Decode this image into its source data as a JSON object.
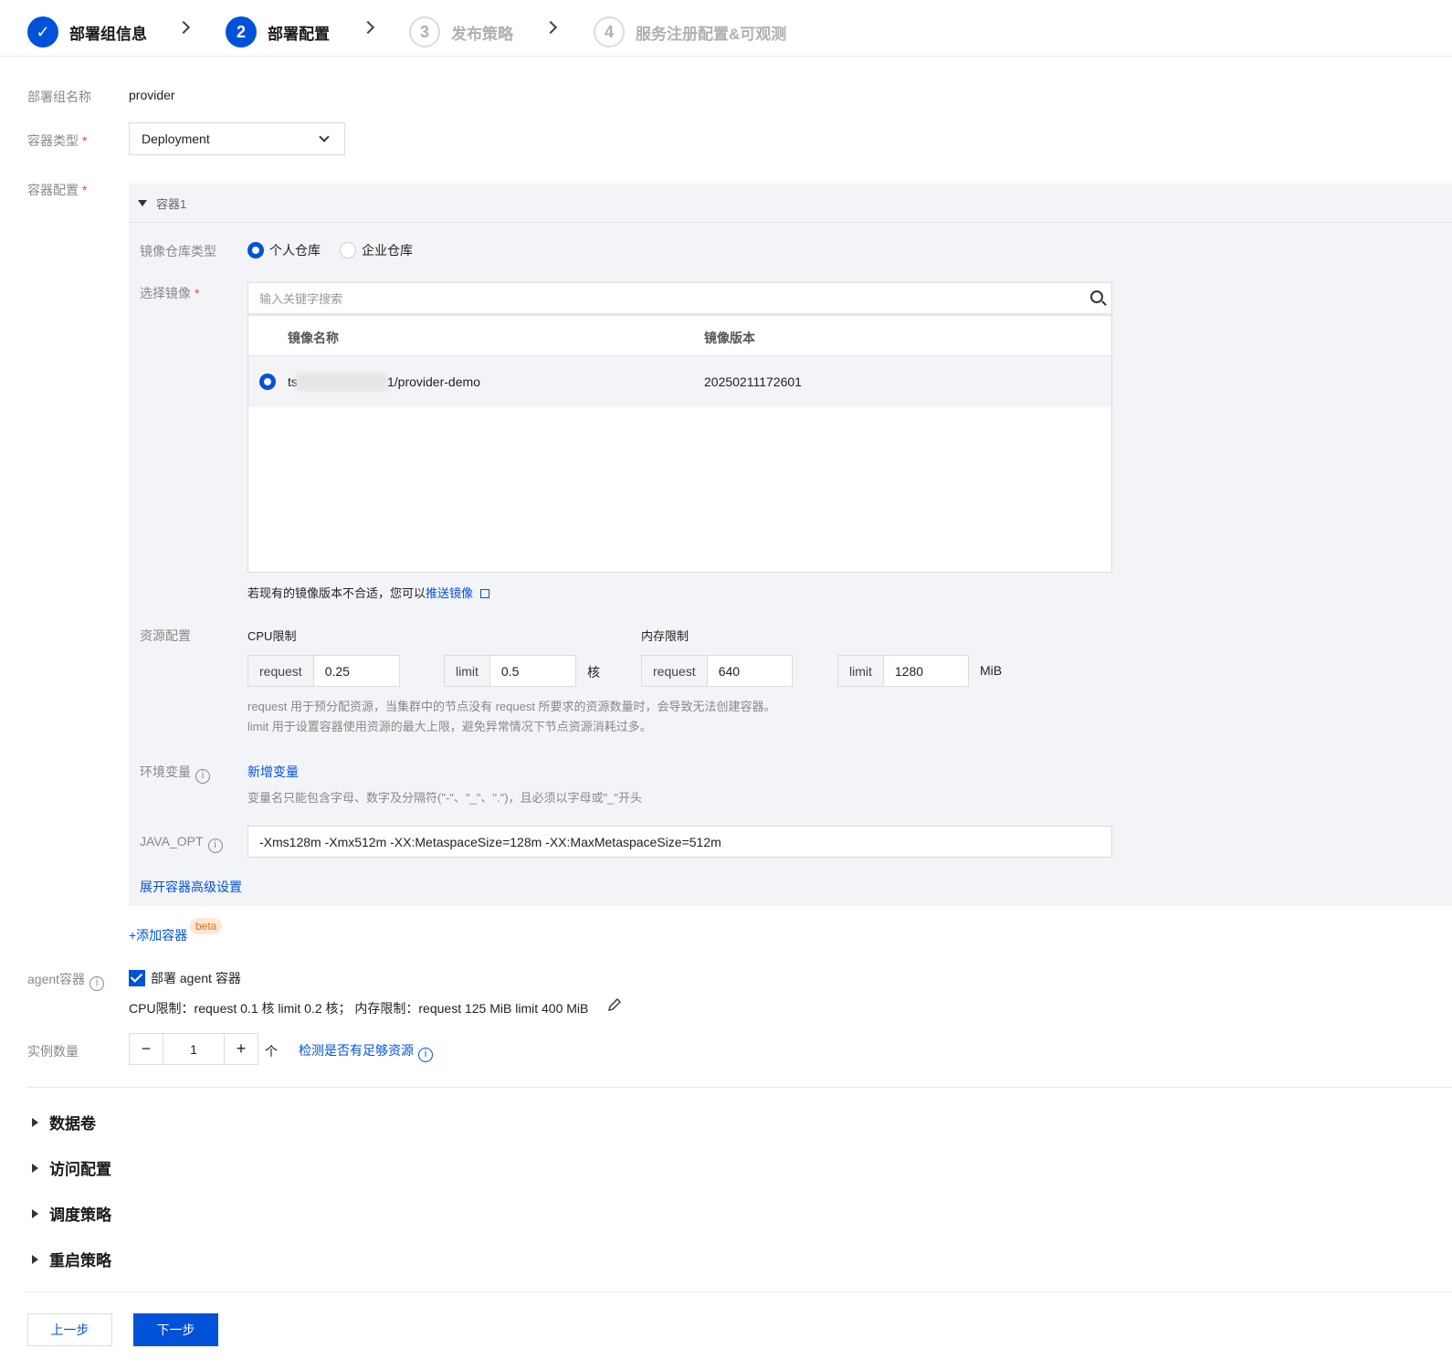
{
  "steps": [
    {
      "num": "✓",
      "label": "部署组信息"
    },
    {
      "num": "2",
      "label": "部署配置"
    },
    {
      "num": "3",
      "label": "发布策略"
    },
    {
      "num": "4",
      "label": "服务注册配置&可观测"
    }
  ],
  "group_name": {
    "label": "部署组名称",
    "value": "provider"
  },
  "container_type": {
    "label": "容器类型",
    "required": "*",
    "value": "Deployment"
  },
  "container_config": {
    "label": "容器配置",
    "required": "*"
  },
  "container1": {
    "title": "容器1",
    "repo_type": {
      "label": "镜像仓库类型",
      "options": [
        "个人仓库",
        "企业仓库"
      ],
      "selected": "个人仓库"
    },
    "select_image": {
      "label": "选择镜像",
      "required": "*",
      "placeholder": "输入关键字搜索"
    },
    "table": {
      "headers": [
        "镜像名称",
        "镜像版本"
      ],
      "rows": [
        {
          "name_prefix": "ts",
          "name_suffix": "1/provider-demo",
          "version": "20250211172601"
        }
      ]
    },
    "push_hint": "若现有的镜像版本不合适，您可以",
    "push_link": "推送镜像",
    "resource": {
      "label": "资源配置",
      "cpu_label": "CPU限制",
      "mem_label": "内存限制",
      "cpu_request_label": "request",
      "cpu_request": "0.25",
      "cpu_limit_label": "limit",
      "cpu_limit": "0.5",
      "cpu_unit": "核",
      "mem_request_label": "request",
      "mem_request": "640",
      "mem_limit_label": "limit",
      "mem_limit": "1280",
      "mem_unit": "MiB",
      "hint1": "request 用于预分配资源，当集群中的节点没有 request 所要求的资源数量时，会导致无法创建容器。",
      "hint2": "limit 用于设置容器使用资源的最大上限，避免异常情况下节点资源消耗过多。"
    },
    "env": {
      "label": "环境变量",
      "add_link": "新增变量",
      "hint": "变量名只能包含字母、数字及分隔符(\"-\"、\"_\"、\".\")，且必须以字母或\"_\"开头"
    },
    "java_opt": {
      "label": "JAVA_OPT",
      "value": "-Xms128m -Xmx512m -XX:MetaspaceSize=128m -XX:MaxMetaspaceSize=512m"
    },
    "advanced_link": "展开容器高级设置"
  },
  "add_container": {
    "label": "+添加容器",
    "badge": "beta"
  },
  "agent": {
    "label": "agent容器",
    "checkbox_label": "部署 agent 容器",
    "limits": "CPU限制：request 0.1 核 limit 0.2 核；  内存限制：request 125 MiB limit 400 MiB"
  },
  "instances": {
    "label": "实例数量",
    "value": "1",
    "unit": "个",
    "check_link": "检测是否有足够资源"
  },
  "sections": [
    "数据卷",
    "访问配置",
    "调度策略",
    "重启策略"
  ],
  "buttons": {
    "prev": "上一步",
    "next": "下一步"
  },
  "colors": {
    "primary": "#0052d9",
    "panel_bg": "#f3f4f7",
    "required": "#e54545"
  }
}
